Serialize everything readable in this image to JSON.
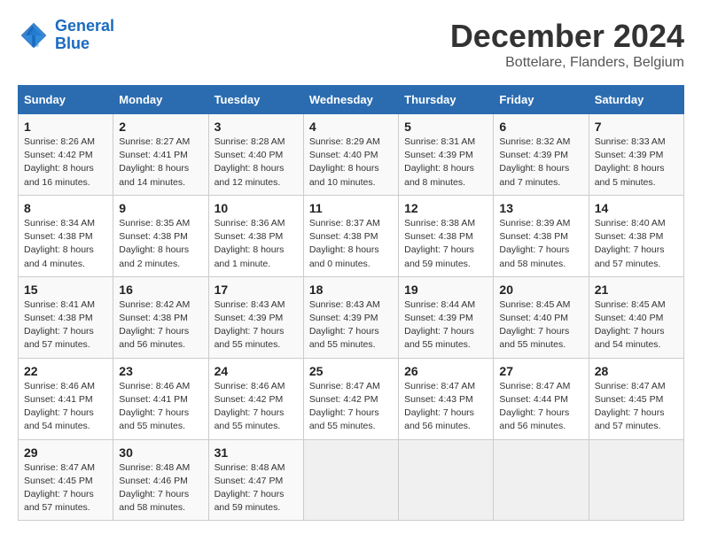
{
  "header": {
    "logo_line1": "General",
    "logo_line2": "Blue",
    "month_title": "December 2024",
    "subtitle": "Bottelare, Flanders, Belgium"
  },
  "columns": [
    "Sunday",
    "Monday",
    "Tuesday",
    "Wednesday",
    "Thursday",
    "Friday",
    "Saturday"
  ],
  "weeks": [
    [
      {
        "day": "1",
        "info": "Sunrise: 8:26 AM\nSunset: 4:42 PM\nDaylight: 8 hours\nand 16 minutes."
      },
      {
        "day": "2",
        "info": "Sunrise: 8:27 AM\nSunset: 4:41 PM\nDaylight: 8 hours\nand 14 minutes."
      },
      {
        "day": "3",
        "info": "Sunrise: 8:28 AM\nSunset: 4:40 PM\nDaylight: 8 hours\nand 12 minutes."
      },
      {
        "day": "4",
        "info": "Sunrise: 8:29 AM\nSunset: 4:40 PM\nDaylight: 8 hours\nand 10 minutes."
      },
      {
        "day": "5",
        "info": "Sunrise: 8:31 AM\nSunset: 4:39 PM\nDaylight: 8 hours\nand 8 minutes."
      },
      {
        "day": "6",
        "info": "Sunrise: 8:32 AM\nSunset: 4:39 PM\nDaylight: 8 hours\nand 7 minutes."
      },
      {
        "day": "7",
        "info": "Sunrise: 8:33 AM\nSunset: 4:39 PM\nDaylight: 8 hours\nand 5 minutes."
      }
    ],
    [
      {
        "day": "8",
        "info": "Sunrise: 8:34 AM\nSunset: 4:38 PM\nDaylight: 8 hours\nand 4 minutes."
      },
      {
        "day": "9",
        "info": "Sunrise: 8:35 AM\nSunset: 4:38 PM\nDaylight: 8 hours\nand 2 minutes."
      },
      {
        "day": "10",
        "info": "Sunrise: 8:36 AM\nSunset: 4:38 PM\nDaylight: 8 hours\nand 1 minute."
      },
      {
        "day": "11",
        "info": "Sunrise: 8:37 AM\nSunset: 4:38 PM\nDaylight: 8 hours\nand 0 minutes."
      },
      {
        "day": "12",
        "info": "Sunrise: 8:38 AM\nSunset: 4:38 PM\nDaylight: 7 hours\nand 59 minutes."
      },
      {
        "day": "13",
        "info": "Sunrise: 8:39 AM\nSunset: 4:38 PM\nDaylight: 7 hours\nand 58 minutes."
      },
      {
        "day": "14",
        "info": "Sunrise: 8:40 AM\nSunset: 4:38 PM\nDaylight: 7 hours\nand 57 minutes."
      }
    ],
    [
      {
        "day": "15",
        "info": "Sunrise: 8:41 AM\nSunset: 4:38 PM\nDaylight: 7 hours\nand 57 minutes."
      },
      {
        "day": "16",
        "info": "Sunrise: 8:42 AM\nSunset: 4:38 PM\nDaylight: 7 hours\nand 56 minutes."
      },
      {
        "day": "17",
        "info": "Sunrise: 8:43 AM\nSunset: 4:39 PM\nDaylight: 7 hours\nand 55 minutes."
      },
      {
        "day": "18",
        "info": "Sunrise: 8:43 AM\nSunset: 4:39 PM\nDaylight: 7 hours\nand 55 minutes."
      },
      {
        "day": "19",
        "info": "Sunrise: 8:44 AM\nSunset: 4:39 PM\nDaylight: 7 hours\nand 55 minutes."
      },
      {
        "day": "20",
        "info": "Sunrise: 8:45 AM\nSunset: 4:40 PM\nDaylight: 7 hours\nand 55 minutes."
      },
      {
        "day": "21",
        "info": "Sunrise: 8:45 AM\nSunset: 4:40 PM\nDaylight: 7 hours\nand 54 minutes."
      }
    ],
    [
      {
        "day": "22",
        "info": "Sunrise: 8:46 AM\nSunset: 4:41 PM\nDaylight: 7 hours\nand 54 minutes."
      },
      {
        "day": "23",
        "info": "Sunrise: 8:46 AM\nSunset: 4:41 PM\nDaylight: 7 hours\nand 55 minutes."
      },
      {
        "day": "24",
        "info": "Sunrise: 8:46 AM\nSunset: 4:42 PM\nDaylight: 7 hours\nand 55 minutes."
      },
      {
        "day": "25",
        "info": "Sunrise: 8:47 AM\nSunset: 4:42 PM\nDaylight: 7 hours\nand 55 minutes."
      },
      {
        "day": "26",
        "info": "Sunrise: 8:47 AM\nSunset: 4:43 PM\nDaylight: 7 hours\nand 56 minutes."
      },
      {
        "day": "27",
        "info": "Sunrise: 8:47 AM\nSunset: 4:44 PM\nDaylight: 7 hours\nand 56 minutes."
      },
      {
        "day": "28",
        "info": "Sunrise: 8:47 AM\nSunset: 4:45 PM\nDaylight: 7 hours\nand 57 minutes."
      }
    ],
    [
      {
        "day": "29",
        "info": "Sunrise: 8:47 AM\nSunset: 4:45 PM\nDaylight: 7 hours\nand 57 minutes."
      },
      {
        "day": "30",
        "info": "Sunrise: 8:48 AM\nSunset: 4:46 PM\nDaylight: 7 hours\nand 58 minutes."
      },
      {
        "day": "31",
        "info": "Sunrise: 8:48 AM\nSunset: 4:47 PM\nDaylight: 7 hours\nand 59 minutes."
      },
      {
        "day": "",
        "info": ""
      },
      {
        "day": "",
        "info": ""
      },
      {
        "day": "",
        "info": ""
      },
      {
        "day": "",
        "info": ""
      }
    ]
  ]
}
